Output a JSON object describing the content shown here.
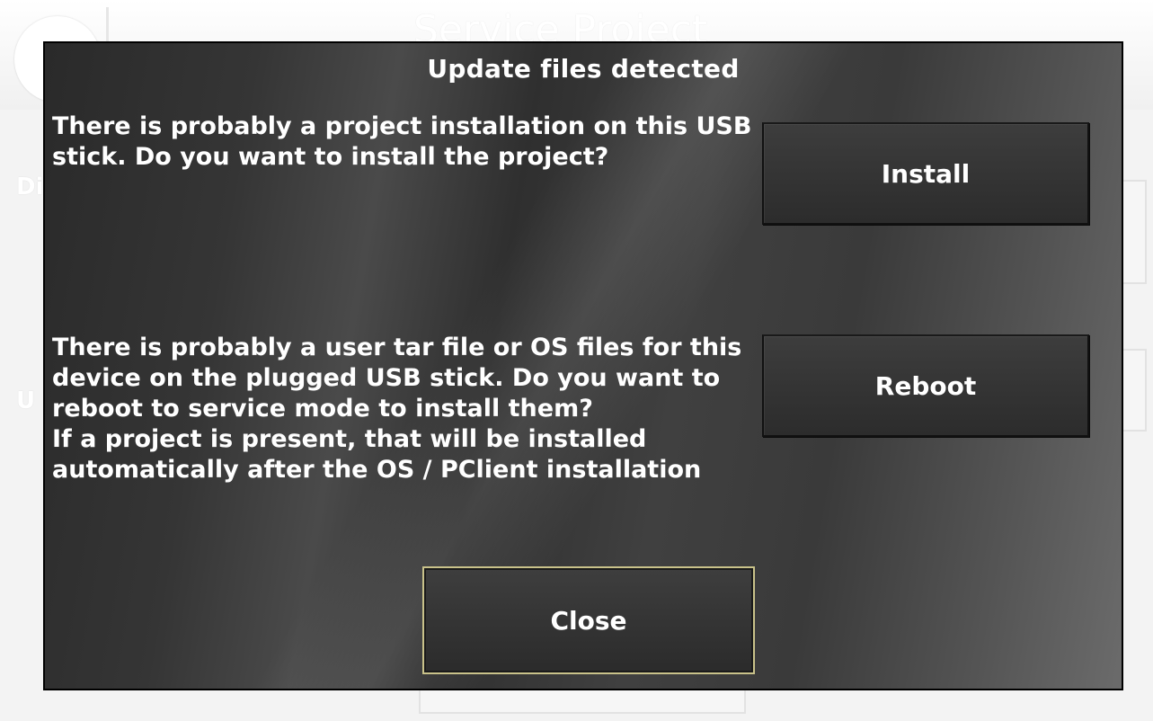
{
  "background": {
    "title": "Service Project",
    "side_labels": [
      "Di pr",
      "U P"
    ]
  },
  "dialog": {
    "title": "Update files detected",
    "project_message": "There is probably a project installation on this USB stick. Do you want to install the project?",
    "os_message_line1": "There is probably a user tar file or OS files for this device on the plugged USB stick. Do you want to reboot to service mode to install them?",
    "os_message_line2": "If a project is present, that will be installed automatically after the OS / PClient installation",
    "install_label": "Install",
    "reboot_label": "Reboot",
    "close_label": "Close"
  },
  "colors": {
    "dialog_bg": "#3a3a3a",
    "text": "#ffffff",
    "close_border": "#c9c28a"
  }
}
